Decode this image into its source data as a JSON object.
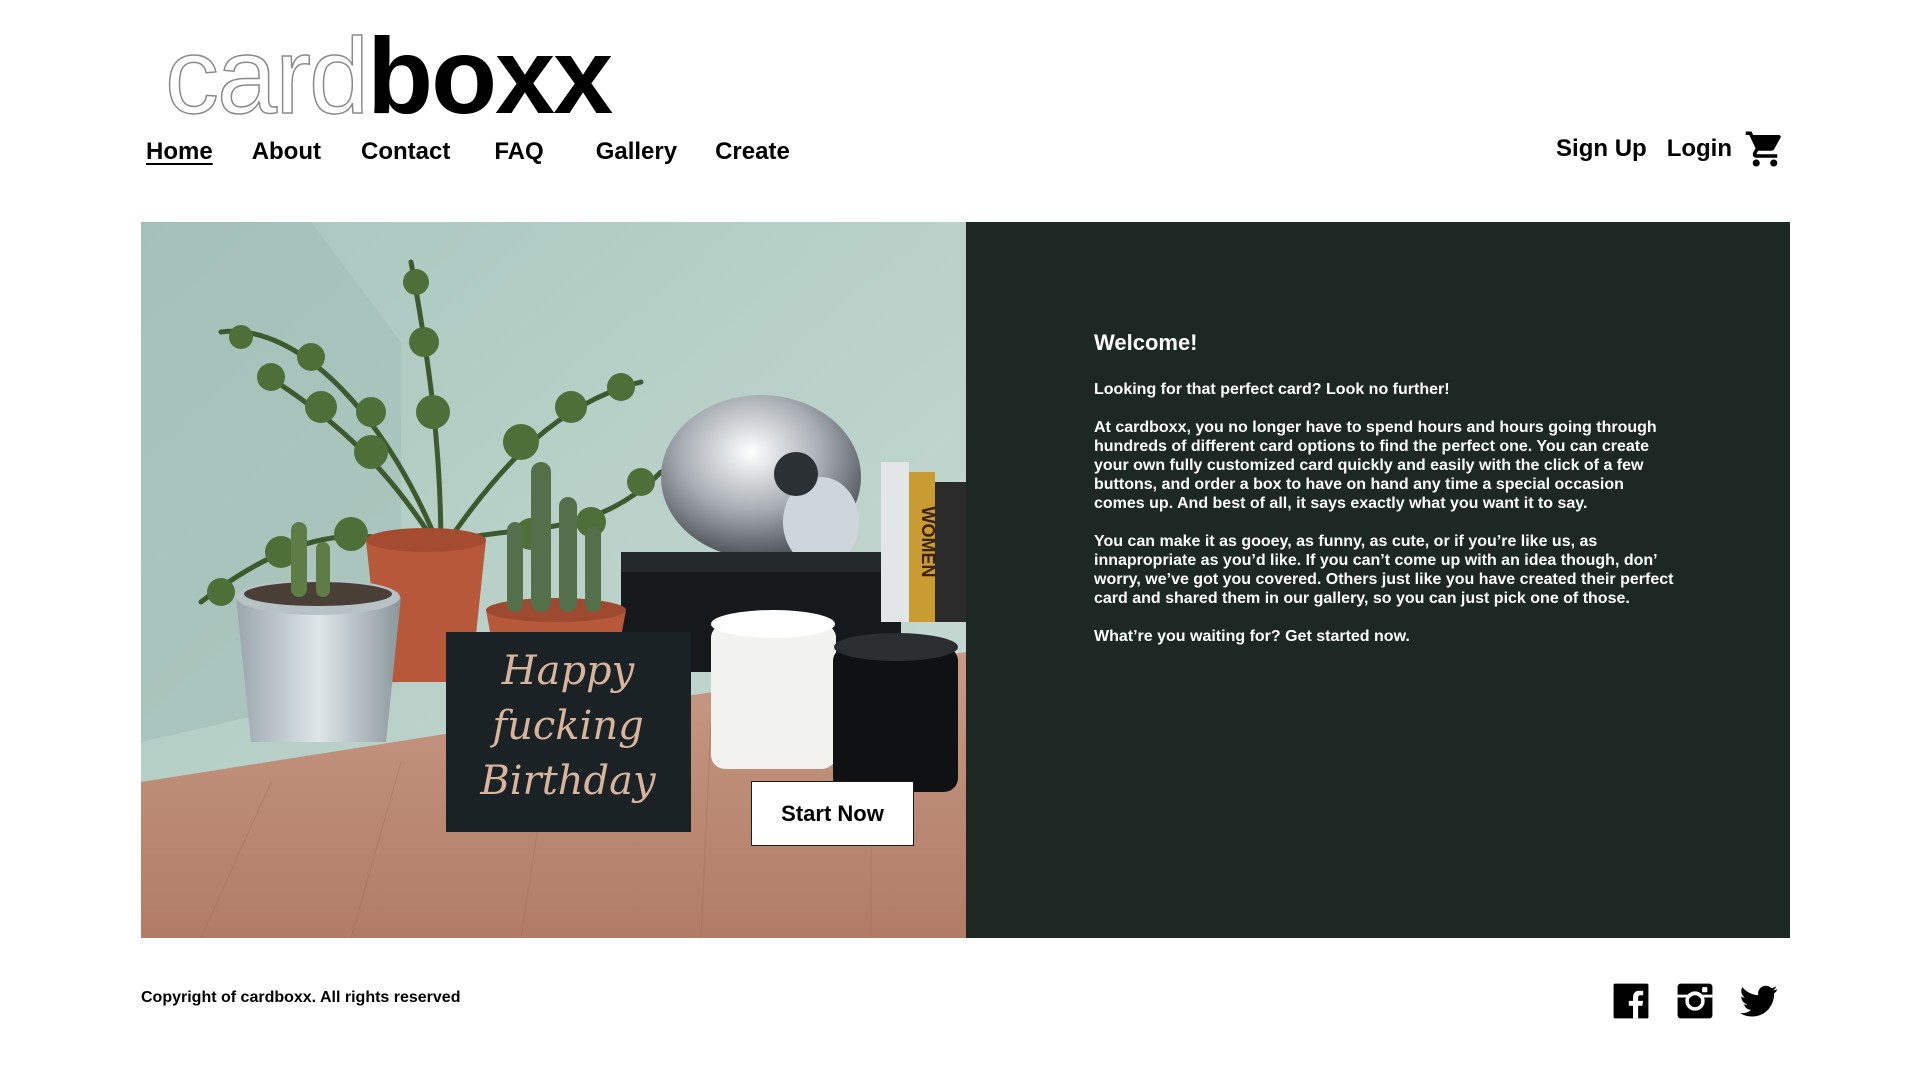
{
  "brand": {
    "logo_outline": "card",
    "logo_solid": "boxx"
  },
  "nav": {
    "items": [
      {
        "label": "Home"
      },
      {
        "label": "About"
      },
      {
        "label": "Contact"
      },
      {
        "label": "FAQ"
      },
      {
        "label": "Gallery"
      },
      {
        "label": "Create"
      }
    ],
    "active": "Home"
  },
  "account": {
    "signup_label": "Sign Up",
    "login_label": "Login",
    "cart_icon": "cart-icon"
  },
  "hero": {
    "button_label": "Start Now",
    "heading": "Welcome!",
    "paragraphs": [
      "Looking for that perfect card? Look no further!",
      "At cardboxx, you no longer have to spend hours and hours going through hundreds of different card options to find the perfect one. You can create your own fully customized card quickly and easily with the click of a few buttons, and order a box to have on hand any time a special occasion comes up. And best of all, it says exactly what you want it to say.",
      "You can make it as gooey, as funny, as cute, or if you’re like us, as innapropriate as you’d like. If you can’t come up with an idea though, don’ worry, we’ve got you covered. Others just like you have created their perfect card and shared them in our gallery, so you can just pick one of those.",
      "What’re you waiting for? Get started now."
    ],
    "card_text": [
      "Happy",
      "fucking",
      "Birthday"
    ],
    "book_spine_text": "WOMEN",
    "panel_color": "#1d2724"
  },
  "footer": {
    "copyright": "Copyright of cardboxx. All rights reserved",
    "social": [
      "facebook-icon",
      "instagram-icon",
      "twitter-icon"
    ]
  }
}
